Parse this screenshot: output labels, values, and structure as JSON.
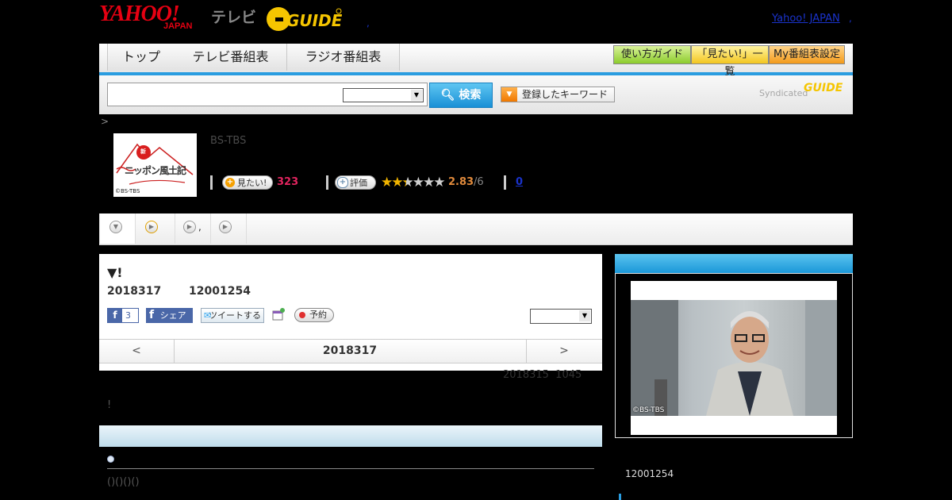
{
  "header": {
    "logo_yahoo": "YAHOO!",
    "logo_japan": "JAPAN",
    "logo_tv": "テレビ",
    "logo_gguide": "GUIDE",
    "dot_left": ",",
    "yahoo_japan_link": "Yahoo! JAPAN",
    "dot_right": ","
  },
  "nav": {
    "tabs": [
      "トップ",
      "テレビ番組表",
      "ラジオ番組表"
    ],
    "buttons": [
      "使い方ガイド",
      "「見たい!」一覧",
      "My番組表設定"
    ]
  },
  "search": {
    "button_label": "検索",
    "keyword_label": "登録したキーワード",
    "syndicated": "Syndicated",
    "syndicated_logo": "GUIDE"
  },
  "breadcrumb": ">",
  "program": {
    "thumb_title": "ニッポン風土記",
    "thumb_prefix": "新",
    "thumb_credit": "©BS-TBS",
    "channel": "BS-TBS",
    "mitai_label": "見たい!",
    "mitai_count": "323",
    "hyoka_label": "評価",
    "rating": "2.83",
    "rating_max": "/6",
    "rating_value": 2.83,
    "review_count": "0"
  },
  "tabs": {
    "items": [
      "",
      ",",
      "",
      ""
    ]
  },
  "detail": {
    "title": "▼!",
    "date": "2018317",
    "duration": "12001254",
    "fb_count": "3",
    "fb_share": "シェア",
    "tweet": "ツイートする",
    "reserve": "予約",
    "prev": "<",
    "current_date": "2018317",
    "next": ">",
    "updated_date": "2018315",
    "updated_time": "1045",
    "note": "!",
    "paren": "()()()()"
  },
  "right": {
    "photo_credit": "©BS-TBS",
    "duration": "12001254"
  },
  "colors": {
    "accent_blue": "#2a9de0",
    "yahoo_red": "#e60012",
    "gguide_yellow": "#f5c500",
    "mitai_red": "#e0245e",
    "rating_orange": "#e08a3c"
  }
}
